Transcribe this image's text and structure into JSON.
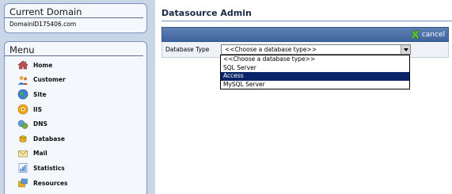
{
  "sidebar": {
    "domain_title": "Current Domain",
    "domain_name": "DomainID175406.com",
    "menu_title": "Menu",
    "items": [
      {
        "label": "Home",
        "icon": "home-icon"
      },
      {
        "label": "Customer",
        "icon": "customer-icon"
      },
      {
        "label": "Site",
        "icon": "site-icon"
      },
      {
        "label": "IIS",
        "icon": "iis-icon"
      },
      {
        "label": "DNS",
        "icon": "dns-icon"
      },
      {
        "label": "Database",
        "icon": "database-icon"
      },
      {
        "label": "Mail",
        "icon": "mail-icon"
      },
      {
        "label": "Statistics",
        "icon": "statistics-icon"
      },
      {
        "label": "Resources",
        "icon": "resources-icon"
      }
    ]
  },
  "main": {
    "title": "Datasource Admin",
    "cancel_label": "cancel",
    "form": {
      "database_type_label": "Database Type",
      "selected_value": "<<Choose a database type>>",
      "options": [
        "<<Choose a database type>>",
        "SQL Server",
        "Access",
        "MySQL Server"
      ],
      "highlighted_option": "Access"
    }
  },
  "colors": {
    "toolbar": "#4a6fa8",
    "highlight": "#0a2468",
    "panel_border": "#7d95bb",
    "background": "#c9d6e8"
  }
}
